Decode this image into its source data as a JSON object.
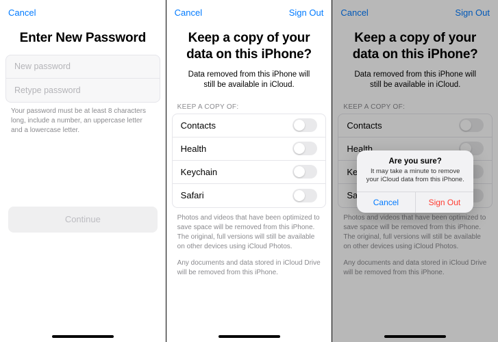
{
  "screen1": {
    "cancel": "Cancel",
    "title": "Enter New Password",
    "placeholder_new": "New password",
    "placeholder_retype": "Retype password",
    "hint": "Your password must be at least 8 characters long, include a number, an uppercase letter and a lowercase letter.",
    "continue": "Continue"
  },
  "screen2": {
    "cancel": "Cancel",
    "sign_out": "Sign Out",
    "title": "Keep a copy of your data on this iPhone?",
    "subtitle": "Data removed from this iPhone will still be available in iCloud.",
    "section": "KEEP A COPY OF:",
    "items": [
      {
        "label": "Contacts"
      },
      {
        "label": "Health"
      },
      {
        "label": "Keychain"
      },
      {
        "label": "Safari"
      }
    ],
    "foot1": "Photos and videos that have been optimized to save space will be removed from this iPhone. The original, full versions will still be available on other devices using iCloud Photos.",
    "foot2": "Any documents and data stored in iCloud Drive will be removed from this iPhone."
  },
  "screen3": {
    "cancel": "Cancel",
    "sign_out": "Sign Out",
    "title": "Keep a copy of your data on this iPhone?",
    "subtitle": "Data removed from this iPhone will still be available in iCloud.",
    "section": "KEEP A COPY OF:",
    "items": [
      {
        "label": "Contacts"
      },
      {
        "label": "Health"
      },
      {
        "label": "Keychain"
      },
      {
        "label": "Safari"
      }
    ],
    "foot1": "Photos and videos that have been optimized to save space will be removed from this iPhone. The original, full versions will still be available on other devices using iCloud Photos.",
    "foot2": "Any documents and data stored in iCloud Drive will be removed from this iPhone.",
    "alert": {
      "title": "Are you sure?",
      "message": "It may take a minute to remove your iCloud data from this iPhone.",
      "cancel": "Cancel",
      "signout": "Sign Out"
    }
  }
}
